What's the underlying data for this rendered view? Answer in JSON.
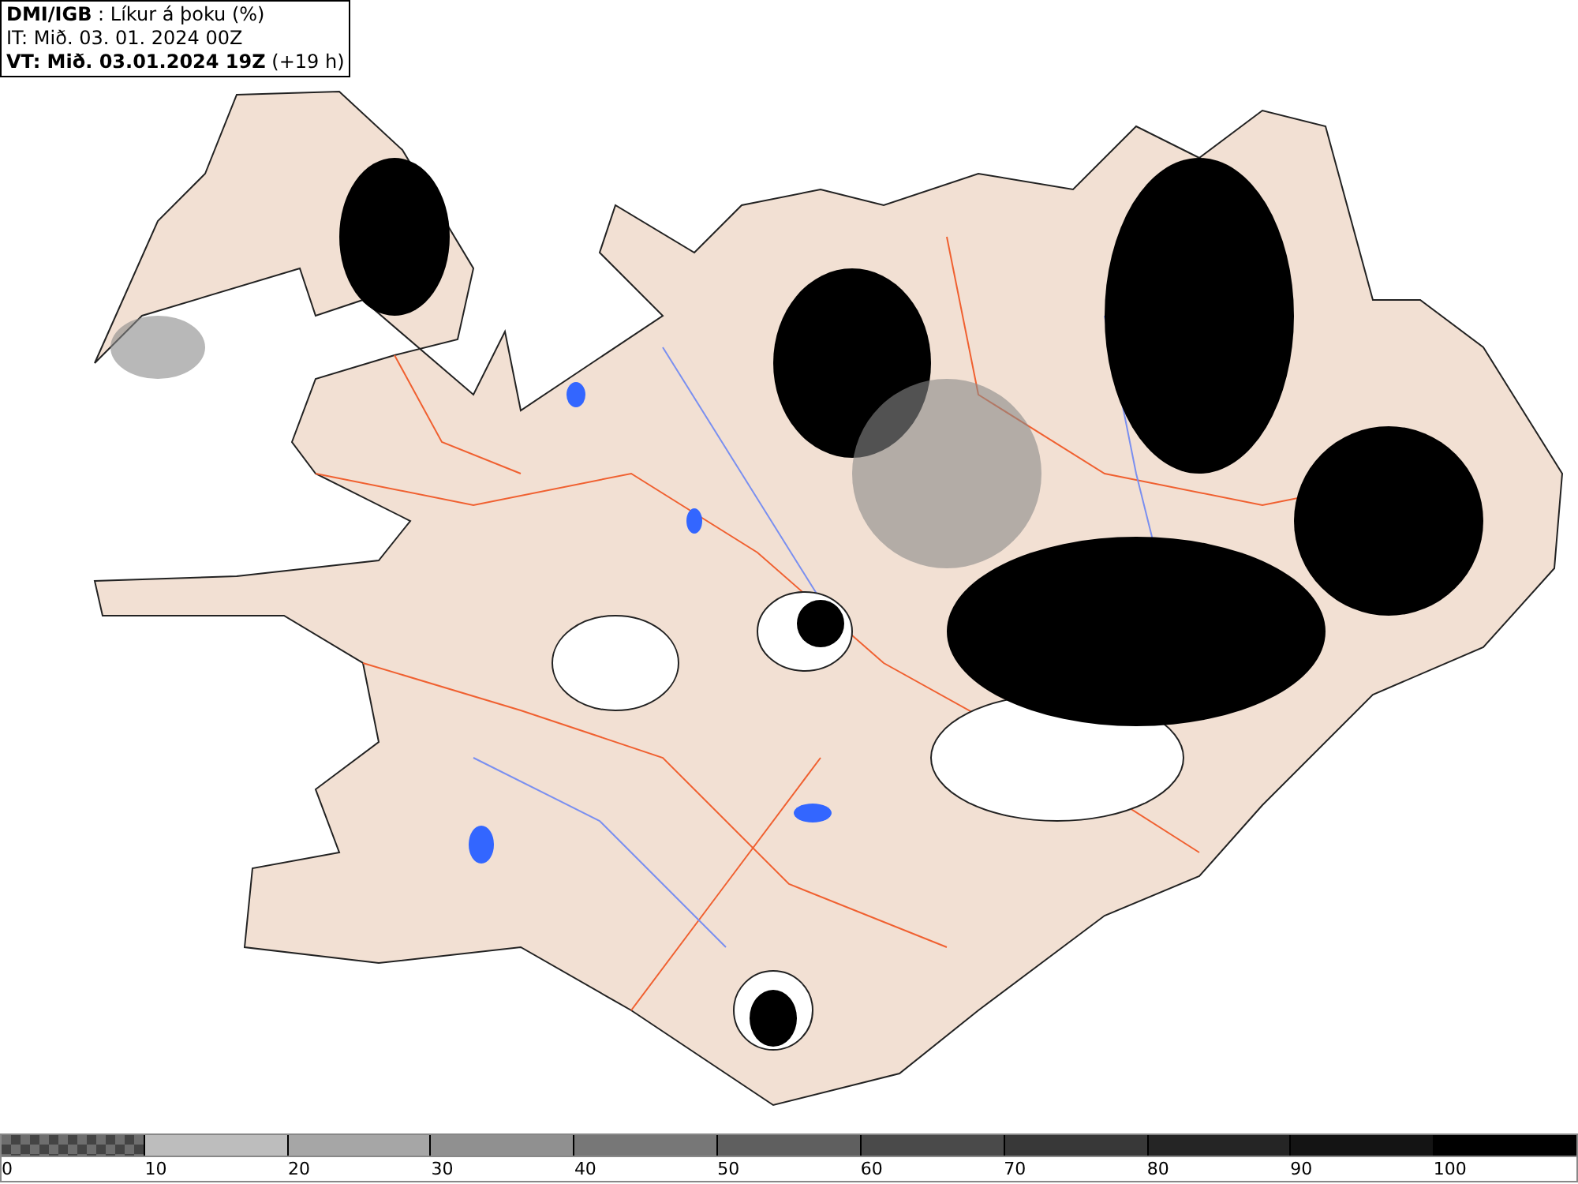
{
  "header": {
    "lines": [
      "**DMI/IGB** : Líkur á þoku (%)",
      "IT: Mið. 03. 01. 2024 00Z",
      "**VT: Mið. 03.01.2024 19Z** (+19 h)"
    ]
  },
  "legend": [
    {
      "label": "0",
      "kind": "checker",
      "color": "#6e6e6e"
    },
    {
      "label": "10",
      "kind": "solid",
      "color": "#bdbdbd"
    },
    {
      "label": "20",
      "kind": "solid",
      "color": "#a6a6a6"
    },
    {
      "label": "30",
      "kind": "solid",
      "color": "#909090"
    },
    {
      "label": "40",
      "kind": "solid",
      "color": "#777777"
    },
    {
      "label": "50",
      "kind": "solid",
      "color": "#5f5f5f"
    },
    {
      "label": "60",
      "kind": "solid",
      "color": "#4a4a4a"
    },
    {
      "label": "70",
      "kind": "solid",
      "color": "#383838"
    },
    {
      "label": "80",
      "kind": "solid",
      "color": "#252525"
    },
    {
      "label": "90",
      "kind": "solid",
      "color": "#141414"
    },
    {
      "label": "100",
      "kind": "solid",
      "color": "#000000"
    }
  ]
}
